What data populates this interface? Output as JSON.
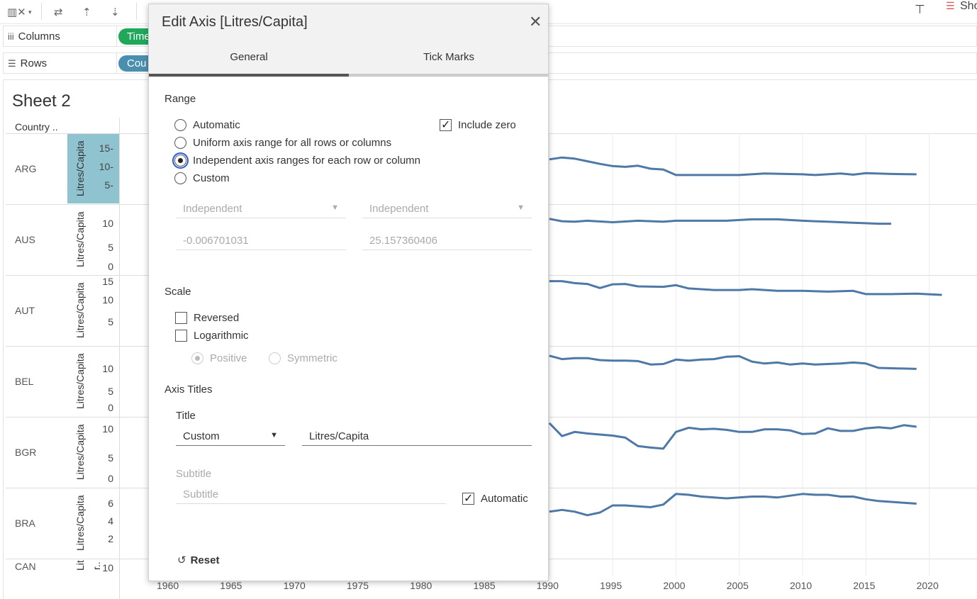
{
  "shelves": {
    "columns": {
      "label": "Columns",
      "pill": "Time"
    },
    "rows": {
      "label": "Rows",
      "pill": "Cou"
    }
  },
  "toolbar": {
    "show_me_label": "Sho"
  },
  "sheet": {
    "title": "Sheet 2",
    "column_header": "Country ..",
    "axis_title": "Litres/Capita",
    "rows": [
      {
        "code": "ARG",
        "ticks": [
          "15-",
          "10-",
          "5-"
        ]
      },
      {
        "code": "AUS",
        "ticks": [
          "10",
          "5",
          "0"
        ]
      },
      {
        "code": "AUT",
        "ticks": [
          "15",
          "10",
          "5"
        ]
      },
      {
        "code": "BEL",
        "ticks": [
          "10",
          "5",
          "0"
        ]
      },
      {
        "code": "BGR",
        "ticks": [
          "10",
          "5",
          "0"
        ]
      },
      {
        "code": "BRA",
        "ticks": [
          "6",
          "4",
          "2"
        ]
      },
      {
        "code": "CAN",
        "ticks": [
          "10"
        ]
      }
    ],
    "can_axis_title": "Lit",
    "can_axis_title2": "r..",
    "x_ticks": [
      "1960",
      "1965",
      "1970",
      "1975",
      "1980",
      "1985",
      "1990",
      "1995",
      "2000",
      "2005",
      "2010",
      "2015",
      "2020"
    ]
  },
  "colors": {
    "line": "#4e79a7",
    "highlight": "#8fc3d0",
    "tab_active": "#555555",
    "tab_inactive": "#cccccc"
  },
  "dialog": {
    "title": "Edit Axis [Litres/Capita]",
    "tabs": [
      {
        "label": "General",
        "active": true
      },
      {
        "label": "Tick Marks",
        "active": false
      }
    ],
    "range": {
      "heading": "Range",
      "options": [
        {
          "label": "Automatic",
          "selected": false
        },
        {
          "label": "Uniform axis range for all rows or columns",
          "selected": false
        },
        {
          "label": "Independent axis ranges for each row or column",
          "selected": true
        },
        {
          "label": "Custom",
          "selected": false
        }
      ],
      "include_zero": {
        "label": "Include zero",
        "checked": true
      },
      "min_mode": "Independent",
      "max_mode": "Independent",
      "min_value": "-0.006701031",
      "max_value": "25.157360406"
    },
    "scale": {
      "heading": "Scale",
      "reversed": {
        "label": "Reversed",
        "checked": false
      },
      "logarithmic": {
        "label": "Logarithmic",
        "checked": false
      },
      "positive": {
        "label": "Positive",
        "selected": true
      },
      "symmetric": {
        "label": "Symmetric",
        "selected": false
      }
    },
    "axis_titles": {
      "heading": "Axis Titles",
      "title_label": "Title",
      "title_mode": "Custom",
      "title_value": "Litres/Capita",
      "subtitle_label": "Subtitle",
      "subtitle_placeholder": "Subtitle",
      "automatic": {
        "label": "Automatic",
        "checked": true
      }
    },
    "reset_label": "Reset"
  },
  "chart_data": {
    "type": "line",
    "x_range": [
      1960,
      2020
    ],
    "visible_x_start": 1990,
    "series": [
      {
        "name": "ARG",
        "x": [
          1990,
          1991,
          1992,
          1993,
          1994,
          1995,
          1996,
          1997,
          1998,
          1999,
          2000,
          2002,
          2005,
          2007,
          2010,
          2011,
          2013,
          2014,
          2015,
          2017,
          2019
        ],
        "y": [
          12,
          12.5,
          12.2,
          11.5,
          10.8,
          10.2,
          10,
          10.3,
          9.5,
          9.3,
          7.8,
          7.8,
          7.8,
          8.2,
          8.0,
          7.8,
          8.2,
          7.9,
          8.3,
          8.1,
          8.0
        ]
      },
      {
        "name": "AUS",
        "x": [
          1990,
          1991,
          1992,
          1993,
          1995,
          1997,
          1999,
          2000,
          2002,
          2004,
          2006,
          2008,
          2010,
          2012,
          2014,
          2015,
          2016,
          2017
        ],
        "y": [
          11.2,
          10.7,
          10.6,
          10.8,
          10.5,
          10.8,
          10.6,
          10.8,
          10.8,
          10.8,
          11.1,
          11.1,
          10.8,
          10.6,
          10.4,
          10.3,
          10.2,
          10.2
        ]
      },
      {
        "name": "AUT",
        "x": [
          1990,
          1991,
          1992,
          1993,
          1994,
          1995,
          1996,
          1997,
          1999,
          2000,
          2001,
          2003,
          2005,
          2006,
          2008,
          2010,
          2012,
          2014,
          2015,
          2017,
          2019,
          2021
        ],
        "y": [
          16,
          16,
          15.5,
          15.3,
          14.3,
          15.2,
          15.3,
          14.7,
          14.6,
          15,
          14.2,
          13.8,
          13.8,
          14,
          13.6,
          13.6,
          13.4,
          13.6,
          12.8,
          12.8,
          12.9,
          12.6
        ]
      },
      {
        "name": "BEL",
        "x": [
          1990,
          1991,
          1992,
          1993,
          1994,
          1995,
          1996,
          1997,
          1998,
          1999,
          2000,
          2001,
          2002,
          2003,
          2004,
          2005,
          2006,
          2007,
          2008,
          2009,
          2010,
          2011,
          2012,
          2013,
          2014,
          2015,
          2016,
          2019
        ],
        "y": [
          12,
          11.3,
          11.5,
          11.5,
          11.1,
          11,
          11,
          10.9,
          10.2,
          10.3,
          11.2,
          11,
          11.2,
          11.3,
          11.8,
          11.9,
          10.8,
          10.4,
          10.6,
          10.2,
          10.4,
          10.2,
          10.3,
          10.4,
          10.6,
          10.4,
          9.5,
          9.3
        ]
      },
      {
        "name": "BGR",
        "x": [
          1990,
          1991,
          1992,
          1993,
          1994,
          1995,
          1996,
          1997,
          1998,
          1999,
          2000,
          2001,
          2002,
          2003,
          2004,
          2005,
          2006,
          2007,
          2008,
          2009,
          2010,
          2011,
          2012,
          2013,
          2014,
          2015,
          2016,
          2017,
          2018,
          2019
        ],
        "y": [
          12,
          9.5,
          10.3,
          10,
          9.8,
          9.6,
          9.2,
          7.6,
          7.3,
          7.1,
          10.3,
          11.1,
          10.8,
          10.9,
          10.7,
          10.3,
          10.3,
          10.8,
          10.8,
          10.6,
          9.9,
          10,
          11,
          10.5,
          10.5,
          11,
          11.2,
          11,
          11.6,
          11.3
        ]
      },
      {
        "name": "BRA",
        "x": [
          1990,
          1991,
          1992,
          1993,
          1994,
          1995,
          1996,
          1997,
          1998,
          1999,
          2000,
          2001,
          2002,
          2003,
          2004,
          2005,
          2006,
          2007,
          2008,
          2009,
          2010,
          2011,
          2012,
          2013,
          2014,
          2015,
          2016,
          2017,
          2018,
          2019
        ],
        "y": [
          5.3,
          5.5,
          5.3,
          4.9,
          5.2,
          6,
          6,
          5.9,
          5.8,
          6.1,
          7.3,
          7.2,
          7,
          6.9,
          6.8,
          6.9,
          7,
          7,
          6.9,
          7.1,
          7.3,
          7.2,
          7.2,
          7,
          7,
          6.7,
          6.5,
          6.4,
          6.3,
          6.2
        ]
      }
    ]
  }
}
